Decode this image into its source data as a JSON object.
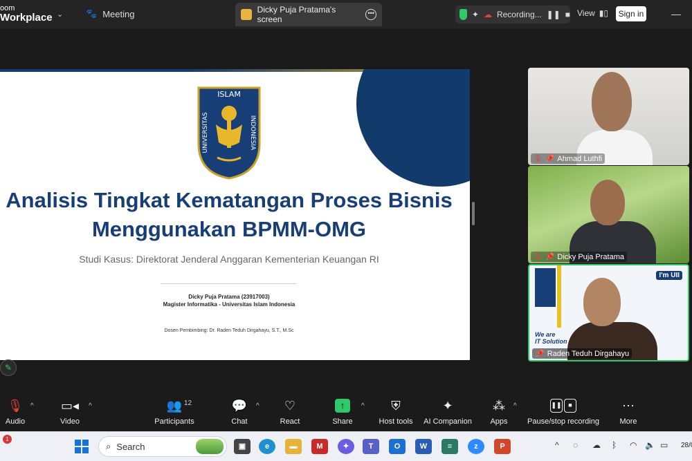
{
  "topbar": {
    "brand_line1": "oom",
    "brand_line2": "Workplace",
    "meeting_tab": "Meeting",
    "screen_tab": "Dicky Puja Pratama's screen",
    "recording_label": "Recording...",
    "view_label": "View",
    "signin_label": "Sign in"
  },
  "slide": {
    "title_line1": "Analisis Tingkat Kematangan Proses Bisnis",
    "title_line2": "Menggunakan BPMM-OMG",
    "subtitle": "Studi Kasus: Direktorat Jenderal Anggaran Kementerian Keuangan RI",
    "author_name": "Dicky Puja Pratama (23917003)",
    "author_program": "Magister Informatika - Universitas Islam Indonesia",
    "advisor": "Dosen Pembimbing: Dr. Raden Teduh Dirgahayu, S.T., M.Sc",
    "logo_top_text": "ISLAM",
    "logo_left_text": "UNIVERSITAS",
    "logo_right_text": "INDONESIA"
  },
  "participants": [
    {
      "name": "Ahmad Luthfi"
    },
    {
      "name": "Dicky Puja Pratama"
    },
    {
      "name": "Raden Teduh Dirgahayu"
    }
  ],
  "tile3_banner": {
    "tag": "I'm UII",
    "slogan_line1": "We are",
    "slogan_line2": "IT Solution"
  },
  "toolbar": {
    "audio": "Audio",
    "video": "Video",
    "participants": "Participants",
    "participants_count": "12",
    "chat": "Chat",
    "react": "React",
    "share": "Share",
    "host_tools": "Host tools",
    "ai_companion": "AI Companion",
    "apps": "Apps",
    "pause_stop": "Pause/stop recording",
    "more": "More"
  },
  "taskbar": {
    "notification_count": "1",
    "search_placeholder": "Search",
    "clock": "28/0"
  },
  "colors": {
    "accent_green": "#2fc86b",
    "slide_title": "#173e76",
    "uii_gold": "#e8b72a"
  }
}
